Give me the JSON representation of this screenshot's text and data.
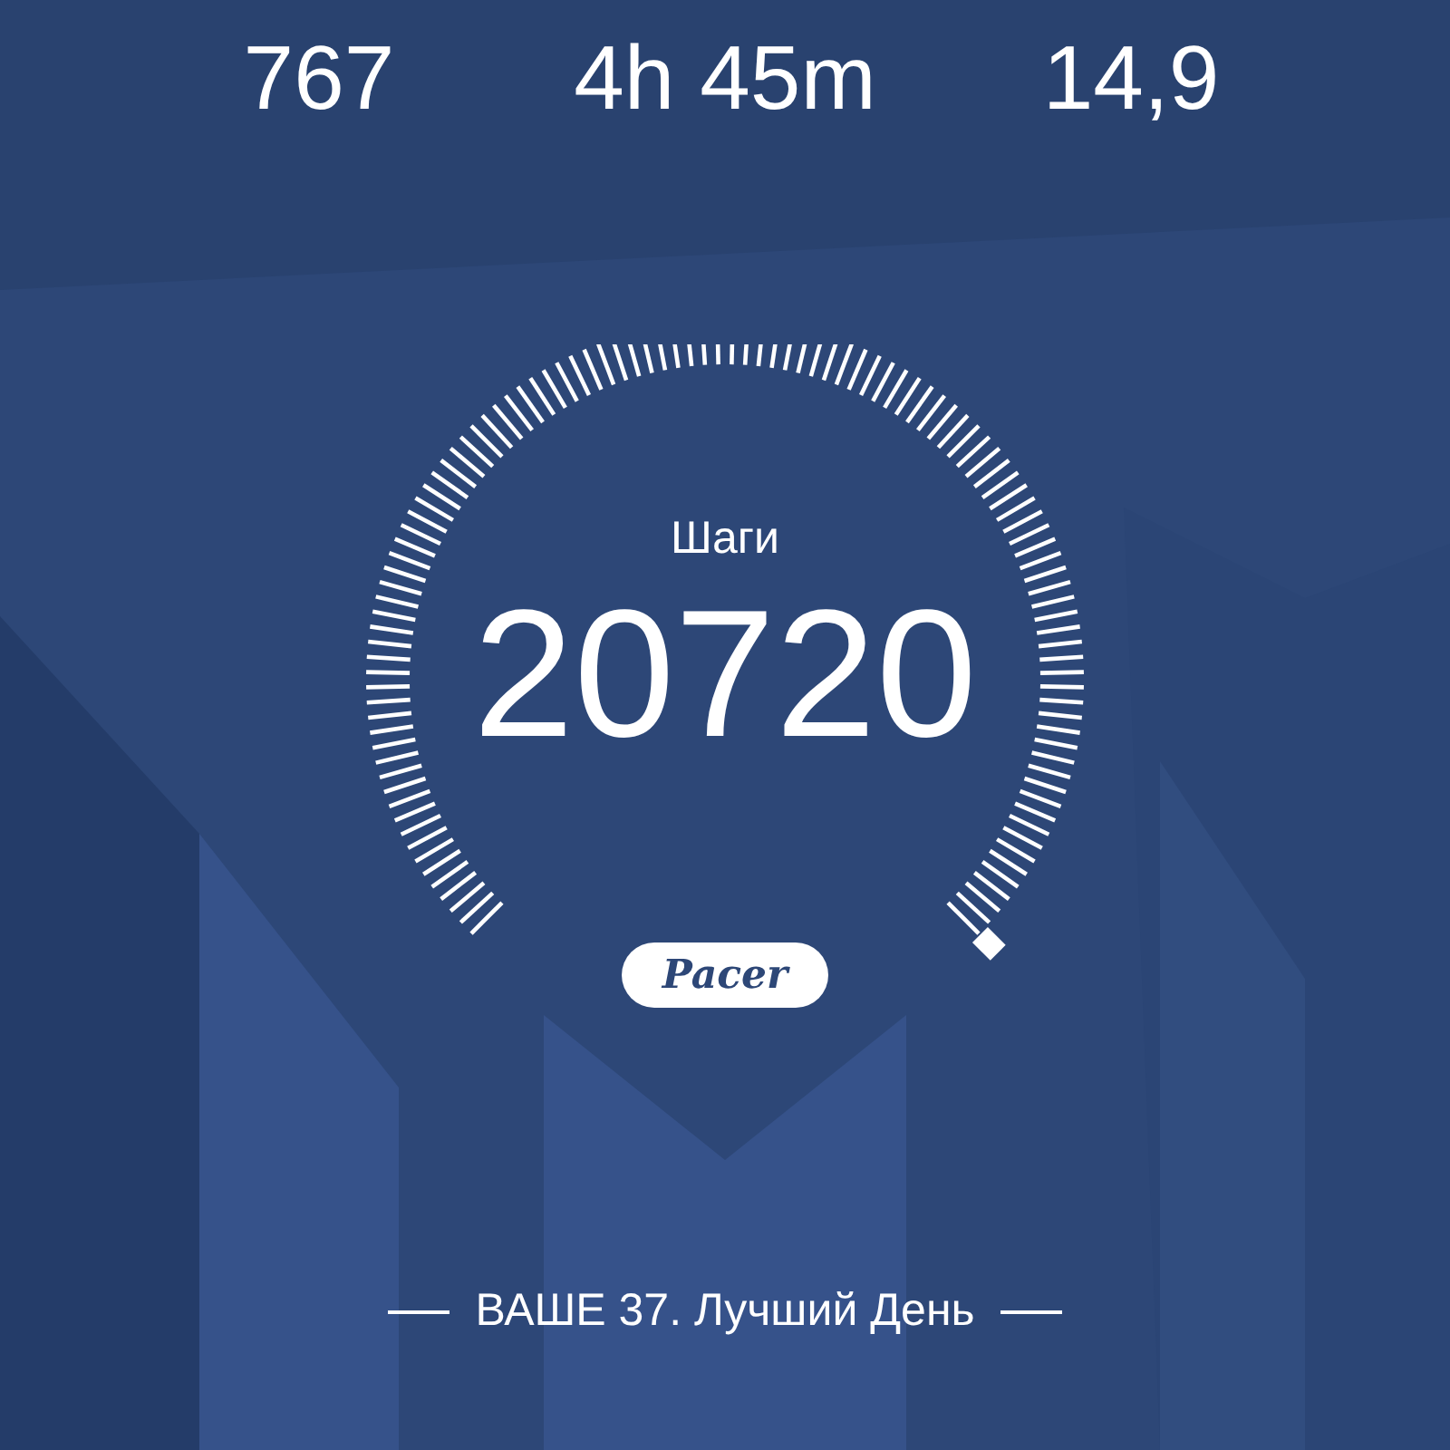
{
  "stats": [
    {
      "value": "767"
    },
    {
      "value": "4h 45m"
    },
    {
      "value": "14,9"
    }
  ],
  "steps": {
    "label": "Шаги",
    "value": "20720"
  },
  "logo": "Pacer",
  "best_day": "ВАШЕ 37. Лучший День"
}
